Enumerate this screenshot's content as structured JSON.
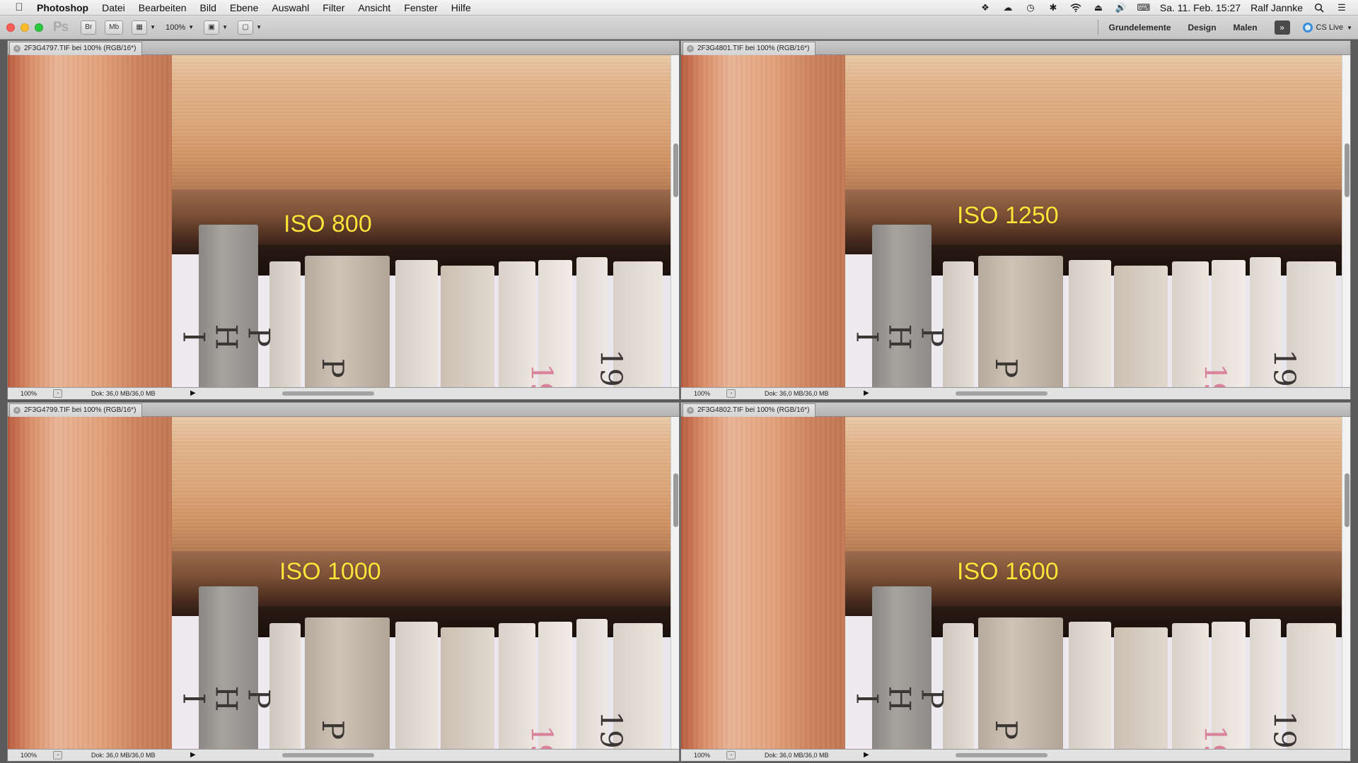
{
  "menubar": {
    "apple": "",
    "items": [
      "Photoshop",
      "Datei",
      "Bearbeiten",
      "Bild",
      "Ebene",
      "Auswahl",
      "Filter",
      "Ansicht",
      "Fenster",
      "Hilfe"
    ],
    "clock": "Sa. 11. Feb. 15:27",
    "user": "Ralf Jannke"
  },
  "appbar": {
    "logo": "Ps",
    "btn_bridge": "Br",
    "btn_minibridge": "Mb",
    "zoom": "100%",
    "workspaces": [
      "Grundelemente",
      "Design",
      "Malen"
    ],
    "more": "»",
    "cslive": "CS Live"
  },
  "documents": [
    {
      "tab": "2F3G4797.TIF bei 100% (RGB/16*)",
      "zoom": "100%",
      "doc_size": "Dok: 36,0 MB/36,0 MB",
      "iso": "ISO 800"
    },
    {
      "tab": "2F3G4801.TIF bei 100% (RGB/16*)",
      "zoom": "100%",
      "doc_size": "Dok: 36,0 MB/36,0 MB",
      "iso": "ISO 1250"
    },
    {
      "tab": "2F3G4799.TIF bei 100% (RGB/16*)",
      "zoom": "100%",
      "doc_size": "Dok: 36,0 MB/36,0 MB",
      "iso": "ISO 1000"
    },
    {
      "tab": "2F3G4802.TIF bei 100% (RGB/16*)",
      "zoom": "100%",
      "doc_size": "Dok: 36,0 MB/36,0 MB",
      "iso": "ISO 1600"
    }
  ],
  "photo": {
    "spine_1": "P\nH\nI",
    "spine_2": "P",
    "spine_3": "19",
    "spine_4": "19"
  }
}
